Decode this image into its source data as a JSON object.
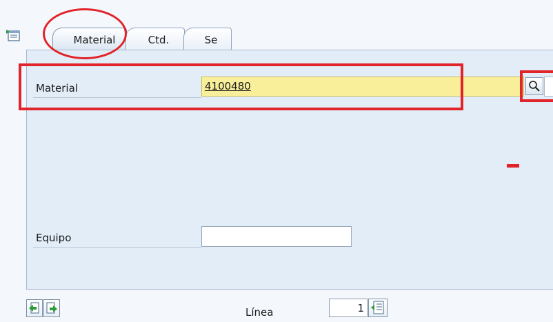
{
  "tabs": [
    {
      "label": "Material",
      "active": true
    },
    {
      "label": "Ctd.",
      "active": false
    },
    {
      "label": "Se",
      "active": false
    }
  ],
  "form": {
    "material_label": "Material",
    "material_value": "4100480",
    "equipo_label": "Equipo",
    "equipo_value": ""
  },
  "footer": {
    "linea_label": "Línea",
    "linea_value": "1"
  },
  "icons": {
    "tree": "tree-toggle-icon",
    "search": "magnifier-icon",
    "prev": "page-previous-icon",
    "next": "page-next-icon",
    "position": "position-line-icon"
  },
  "colors": {
    "required_field": "#f9ef9a",
    "panel": "#e2edf7",
    "annotation": "#e1232a"
  }
}
